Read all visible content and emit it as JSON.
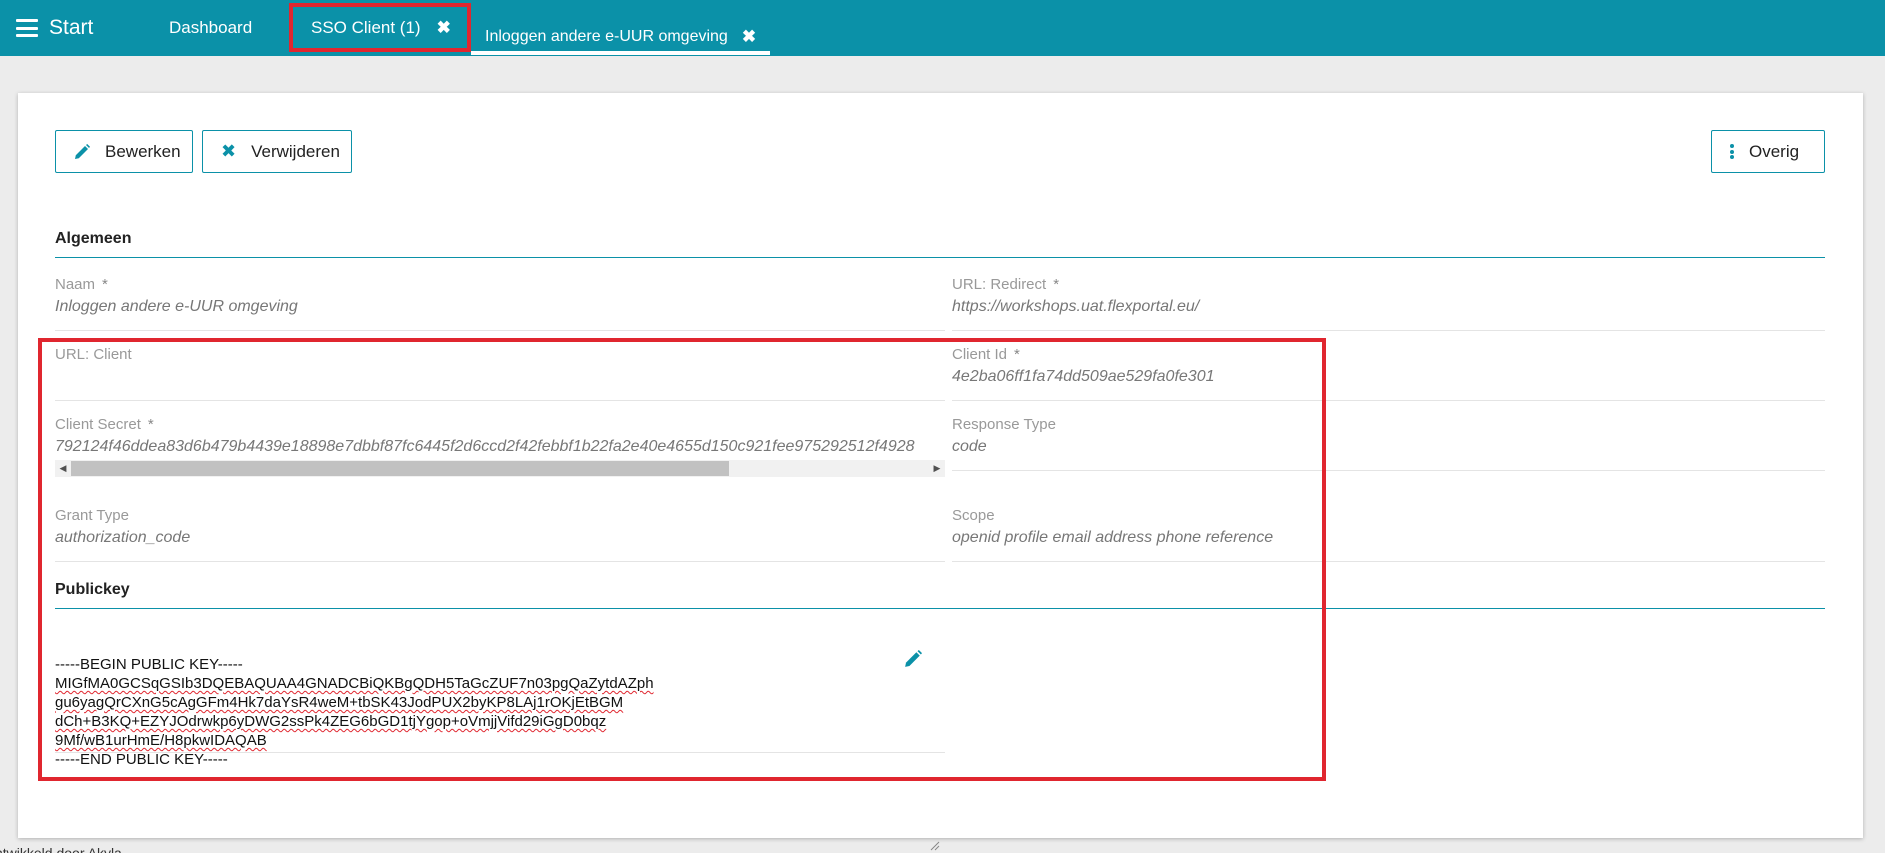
{
  "header": {
    "menu_label": "Start",
    "tabs": [
      {
        "label": "Dashboard"
      },
      {
        "label": "SSO Client (1)"
      },
      {
        "label": "Inloggen andere e-UUR omgeving"
      }
    ]
  },
  "toolbar": {
    "edit_label": "Bewerken",
    "delete_label": "Verwijderen",
    "more_label": "Overig"
  },
  "sections": {
    "general_title": "Algemeen",
    "publickey_title": "Publickey"
  },
  "fields": {
    "naam": {
      "label": "Naam",
      "required": "*",
      "value": "Inloggen andere e-UUR omgeving"
    },
    "url_redirect": {
      "label": "URL: Redirect",
      "required": "*",
      "value": "https://workshops.uat.flexportal.eu/"
    },
    "url_client": {
      "label": "URL: Client",
      "value": ""
    },
    "client_id": {
      "label": "Client Id",
      "required": "*",
      "value": "4e2ba06ff1fa74dd509ae529fa0fe301"
    },
    "client_secret": {
      "label": "Client Secret",
      "required": "*",
      "value": "792124f46ddea83d6b479b4439e18898e7dbbf87fc6445f2d6ccd2f42febbf1b22fa2e40e4655d150c921fee975292512f4928"
    },
    "response_type": {
      "label": "Response Type",
      "value": "code"
    },
    "grant_type": {
      "label": "Grant Type",
      "value": "authorization_code"
    },
    "scope": {
      "label": "Scope",
      "value": "openid profile email address phone reference"
    }
  },
  "publickey": {
    "lines": [
      "-----BEGIN PUBLIC KEY-----",
      "MIGfMA0GCSqGSIb3DQEBAQUAA4GNADCBiQKBgQDH5TaGcZUF7n03pgQaZytdAZph",
      "gu6yagQrCXnG5cAgGFm4Hk7daYsR4weM+tbSK43JodPUX2byKP8LAj1rOKjEtBGM",
      "dCh+B3KQ+EZYJOdrwkp6yDWG2ssPk4ZEG6bGD1tjYgop+oVmjjVifd29iGgD0bqz",
      "9Mf/wB1urHmE/H8pkwIDAQAB",
      "-----END PUBLIC KEY-----"
    ]
  },
  "footer": {
    "text": "ntwikkeld door Akyla"
  },
  "colors": {
    "brand": "#0b91a8",
    "highlight": "#e0262f"
  }
}
